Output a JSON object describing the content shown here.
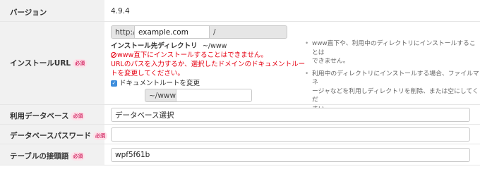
{
  "version": {
    "label": "バージョン",
    "value": "4.9.4"
  },
  "install_url": {
    "label": "インストールURL",
    "required_badge": "必須",
    "protocol": "http://",
    "domain_value": "example.com",
    "slash": "/",
    "path_value": "",
    "install_dir_label": "インストール先ディレクトリ",
    "install_dir_value": "~/www",
    "error_line": "www直下にインストールすることはできません。",
    "hint_line1": "URLのパスを入力するか、選択したドメインのドキュメントルー",
    "hint_line2": "トを変更してください。",
    "change_docroot_label": "ドキュメントルートを変更",
    "docroot_prefix": "~/www/",
    "docroot_value": "",
    "notes": [
      [
        "www直下や、利用中のディレクトリにインストールすることは",
        "できません。"
      ],
      [
        "利用中のディレクトリにインストールする場合、ファイルマネ",
        "ージャなどを利用しディレクトリを削除、または空にしてくだ",
        "さい。"
      ]
    ]
  },
  "database": {
    "label": "利用データベース",
    "required_badge": "必須",
    "value": "データベース選択"
  },
  "db_password": {
    "label": "データベースパスワード",
    "required_badge": "必須",
    "value": ""
  },
  "table_prefix": {
    "label": "テーブルの接頭語",
    "required_badge": "必須",
    "value": "wpf5f61b"
  },
  "colors": {
    "required_bg": "#fde3ea",
    "required_text": "#d6336c",
    "error": "#e60012",
    "checkbox": "#3d8ddc"
  }
}
